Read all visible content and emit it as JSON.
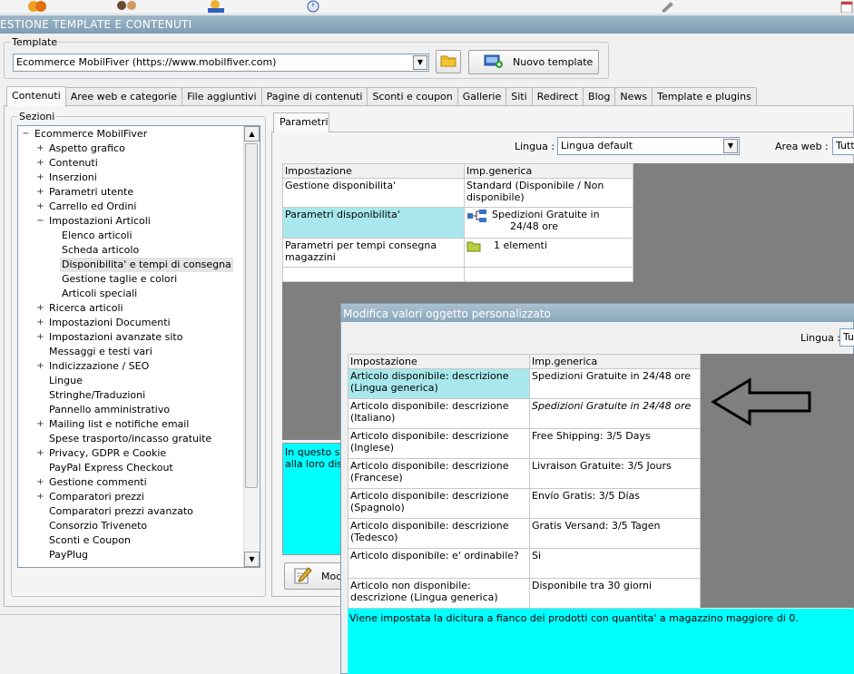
{
  "window": {
    "title": "ESTIONE TEMPLATE E CONTENUTI"
  },
  "template": {
    "legend": "Template",
    "selected": "Ecommerce MobilFiver (https://www.mobilfiver.com)",
    "new_button": "Nuovo template"
  },
  "tabs": [
    {
      "label": "Contenuti",
      "active": true
    },
    {
      "label": "Aree web e categorie"
    },
    {
      "label": "File aggiuntivi"
    },
    {
      "label": "Pagine di contenuti"
    },
    {
      "label": "Sconti e coupon"
    },
    {
      "label": "Gallerie"
    },
    {
      "label": "Siti"
    },
    {
      "label": "Redirect"
    },
    {
      "label": "Blog"
    },
    {
      "label": "News"
    },
    {
      "label": "Template e plugins"
    }
  ],
  "sections": {
    "legend": "Sezioni",
    "tree": [
      {
        "label": "Ecommerce MobilFiver",
        "level": 0,
        "exp": "−"
      },
      {
        "label": "Aspetto grafico",
        "level": 1,
        "exp": "+"
      },
      {
        "label": "Contenuti",
        "level": 1,
        "exp": "+"
      },
      {
        "label": "Inserzioni",
        "level": 1,
        "exp": "+"
      },
      {
        "label": "Parametri utente",
        "level": 1,
        "exp": "+"
      },
      {
        "label": "Carrello ed Ordini",
        "level": 1,
        "exp": "+"
      },
      {
        "label": "Impostazioni Articoli",
        "level": 1,
        "exp": "−"
      },
      {
        "label": "Elenco articoli",
        "level": 2
      },
      {
        "label": "Scheda articolo",
        "level": 2
      },
      {
        "label": "Disponibilita' e tempi di consegna",
        "level": 2,
        "selected": true
      },
      {
        "label": "Gestione taglie e colori",
        "level": 2
      },
      {
        "label": "Articoli speciali",
        "level": 2
      },
      {
        "label": "Ricerca articoli",
        "level": 1,
        "exp": "+"
      },
      {
        "label": "Impostazioni Documenti",
        "level": 1,
        "exp": "+"
      },
      {
        "label": "Impostazioni avanzate sito",
        "level": 1,
        "exp": "+"
      },
      {
        "label": "Messaggi e testi vari",
        "level": 1
      },
      {
        "label": "Indicizzazione / SEO",
        "level": 1,
        "exp": "+"
      },
      {
        "label": "Lingue",
        "level": 1
      },
      {
        "label": "Stringhe/Traduzioni",
        "level": 1
      },
      {
        "label": "Pannello amministrativo",
        "level": 1
      },
      {
        "label": "Mailing list e notifiche email",
        "level": 1,
        "exp": "+"
      },
      {
        "label": "Spese trasporto/incasso gratuite",
        "level": 1
      },
      {
        "label": "Privacy, GDPR e Cookie",
        "level": 1,
        "exp": "+"
      },
      {
        "label": "PayPal Express Checkout",
        "level": 1
      },
      {
        "label": "Gestione commenti",
        "level": 1,
        "exp": "+"
      },
      {
        "label": "Comparatori prezzi",
        "level": 1,
        "exp": "+"
      },
      {
        "label": "Comparatori prezzi avanzato",
        "level": 1
      },
      {
        "label": "Consorzio Triveneto",
        "level": 1
      },
      {
        "label": "Sconti e Coupon",
        "level": 1
      },
      {
        "label": "PayPlug",
        "level": 1
      }
    ]
  },
  "params": {
    "tab": "Parametri",
    "lingua_label": "Lingua :",
    "lingua_value": "Lingua default",
    "area_label": "Area web :",
    "area_value": "Tutt",
    "headers": [
      "Impostazione",
      "Imp.generica"
    ],
    "rows": [
      {
        "key": "Gestione disponibilita'",
        "value": "Standard (Disponibile / Non disponibile)"
      },
      {
        "key": "Parametri disponibilita'",
        "value": "Spedizioni Gratuite in 24/48 ore"
      },
      {
        "key": "Parametri per tempi consegna magazzini",
        "value": "1 elementi"
      }
    ],
    "desc": "In questo set\nalla loro dispo",
    "mod_button": "Mod"
  },
  "dialog": {
    "title": "Modifica valori oggetto personalizzato",
    "lingua_label": "Lingua :",
    "lingua_value": "Tu",
    "headers": [
      "Impostazione",
      "Imp.generica"
    ],
    "rows": [
      {
        "key": "Articolo disponibile: descrizione (Lingua generica)",
        "value": "Spedizioni Gratuite in 24/48 ore"
      },
      {
        "key": "Articolo disponibile: descrizione (Italiano)",
        "value": "Spedizioni Gratuite in 24/48 ore"
      },
      {
        "key": "Articolo disponibile: descrizione (Inglese)",
        "value": "Free Shipping: 3/5 Days"
      },
      {
        "key": "Articolo disponibile: descrizione (Francese)",
        "value": "Livraison Gratuite: 3/5 Jours"
      },
      {
        "key": "Articolo disponibile: descrizione (Spagnolo)",
        "value": "Envío Gratis: 3/5 Días"
      },
      {
        "key": "Articolo disponibile: descrizione (Tedesco)",
        "value": "Gratis Versand: 3/5 Tagen"
      },
      {
        "key": "Articolo disponibile: e' ordinabile?",
        "value": "Si"
      },
      {
        "key": "Articolo non disponibile: descrizione (Lingua generica)",
        "value": "Disponibile tra 30 giorni"
      }
    ],
    "desc": "Viene impostata la dicitura a fianco dei prodotti con quantita' a magazzino maggiore di 0."
  },
  "icons": {
    "arrow": "left-arrow-annotation-icon",
    "folder": "folder-icon",
    "new_template": "add-template-icon",
    "edit": "edit-icon",
    "hierarchy": "hierarchy-icon"
  }
}
